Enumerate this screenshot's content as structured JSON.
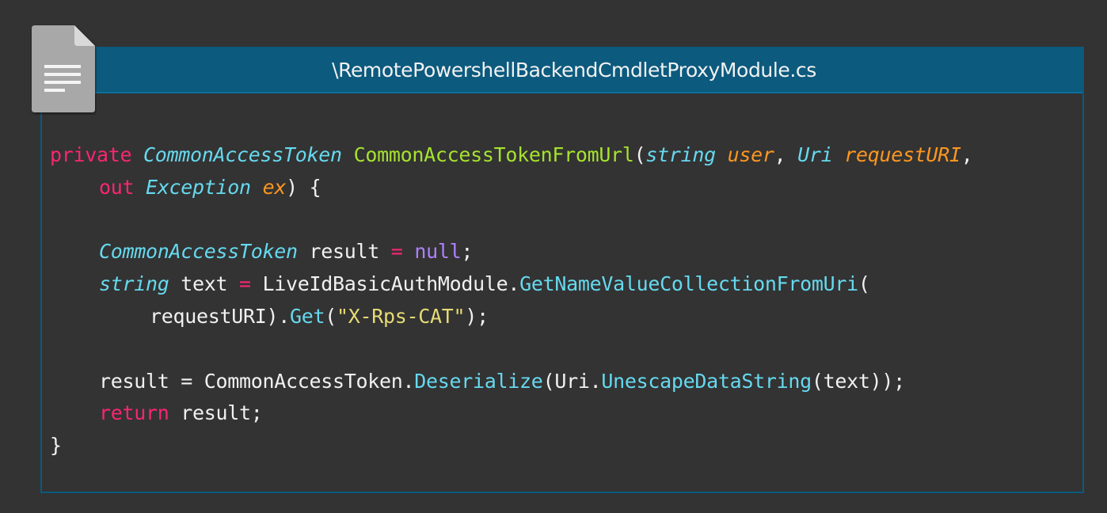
{
  "window": {
    "file_title": "\\RemotePowershellBackendCmdletProxyModule.cs",
    "file_icon": "document-icon"
  },
  "colors": {
    "background": "#333333",
    "title_bar": "#0c5a7e",
    "keyword": "#f92672",
    "type": "#66d9ef",
    "function": "#a6e22e",
    "parameter": "#fd971f",
    "literal": "#ae81ff",
    "string": "#e6db74"
  },
  "code": {
    "l1": {
      "kw_private": "private",
      "type_token": "CommonAccessToken",
      "fn_name": "CommonAccessTokenFromUrl",
      "paren_open": "(",
      "type_string": "string",
      "param_user": "user",
      "comma1": ", ",
      "type_uri": "Uri",
      "param_request": "requestURI",
      "comma2": ","
    },
    "l2": {
      "kw_out": "out",
      "type_exception": "Exception",
      "param_ex": "ex",
      "tail": ") {"
    },
    "l4": {
      "type_token": "CommonAccessToken",
      "var": " result ",
      "op": "=",
      "lit_null": "null",
      "semi": ";"
    },
    "l5": {
      "type_string": "string",
      "var": " text ",
      "op": "=",
      "cls": " LiveIdBasicAuthModule.",
      "method": "GetNameValueCollectionFromUri",
      "paren": "("
    },
    "l6": {
      "arg": "requestURI).",
      "method": "Get",
      "paren_open": "(",
      "str": "\"X-Rps-CAT\"",
      "tail": ");"
    },
    "l8": {
      "lhs": "result = CommonAccessToken.",
      "method1": "Deserialize",
      "mid": "(Uri.",
      "method2": "UnescapeDataString",
      "tail": "(text));"
    },
    "l9": {
      "kw_return": "return",
      "tail": " result;"
    },
    "l10": {
      "brace": "}"
    }
  }
}
